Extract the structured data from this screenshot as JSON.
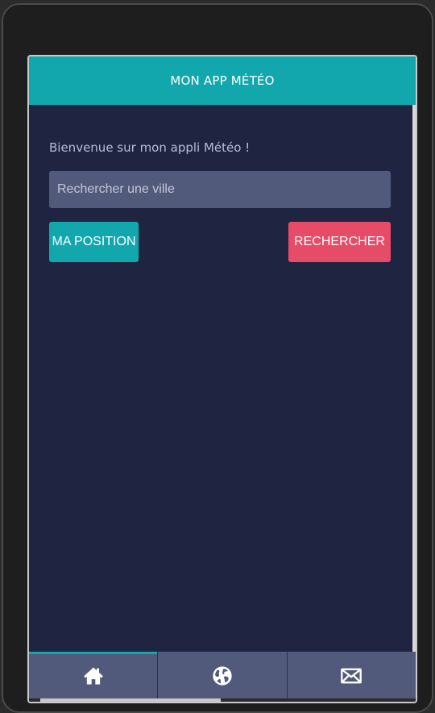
{
  "header": {
    "title": "MON APP MÉTÉO"
  },
  "main": {
    "welcome_text": "Bienvenue sur mon appli Météo !",
    "search": {
      "placeholder": "Rechercher une ville",
      "value": ""
    },
    "buttons": {
      "position_label": "MA POSITION",
      "search_label": "RECHERCHER"
    }
  },
  "tabbar": {
    "tabs": [
      {
        "icon": "home-icon",
        "active": true
      },
      {
        "icon": "globe-icon",
        "active": false
      },
      {
        "icon": "envelope-icon",
        "active": false
      }
    ]
  },
  "colors": {
    "accent": "#12a7ad",
    "danger": "#e64b67",
    "background": "#1f2440",
    "input": "#525a7b",
    "text_muted": "#b8bdd6"
  }
}
